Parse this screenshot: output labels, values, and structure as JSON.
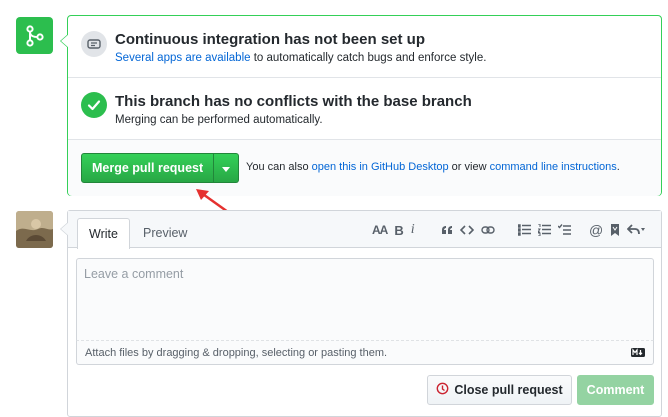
{
  "merge_panel": {
    "ci": {
      "title": "Continuous integration has not been set up",
      "link_text": "Several apps are available",
      "rest_text": " to automatically catch bugs and enforce style."
    },
    "conflicts": {
      "title": "This branch has no conflicts with the base branch",
      "subtitle": "Merging can be performed automatically."
    },
    "merge": {
      "button_label": "Merge pull request",
      "note_prefix": "You can also ",
      "desktop_link": "open this in GitHub Desktop",
      "note_middle": " or view ",
      "cli_link": "command line instructions",
      "note_suffix": "."
    }
  },
  "comment": {
    "tabs": {
      "write": "Write",
      "preview": "Preview"
    },
    "toolbar": {
      "header": "AA",
      "bold": "B",
      "italic": "i"
    },
    "placeholder": "Leave a comment",
    "attach_text": "Attach files by dragging & dropping, selecting or pasting them.",
    "close_button": "Close pull request",
    "comment_button": "Comment"
  },
  "colors": {
    "success": "#2cbe4e",
    "link": "#0366d6",
    "border_success": "#34d058",
    "annotation_arrow": "#e5312f"
  },
  "icons": [
    "git-merge-icon",
    "ci-icon",
    "check-icon",
    "caret-down-icon",
    "red-arrow-annotation",
    "markdown-icon",
    "close-pr-icon"
  ]
}
